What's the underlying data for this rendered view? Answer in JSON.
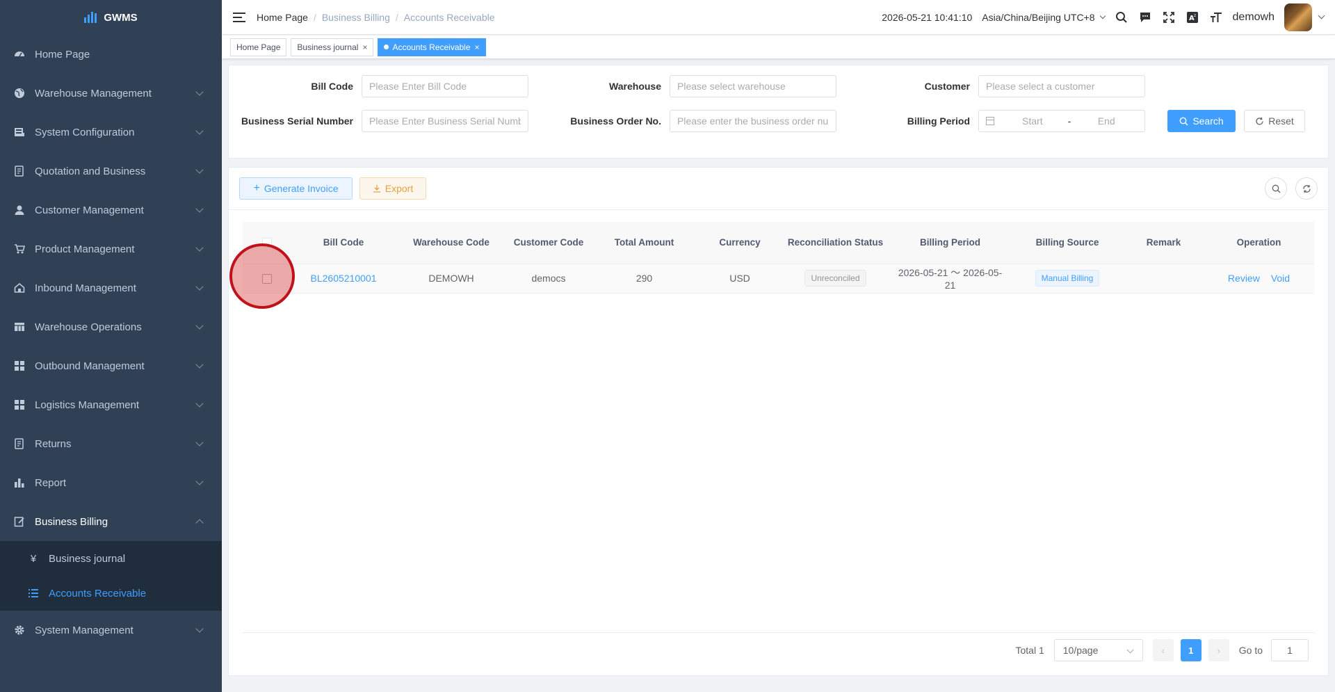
{
  "app": {
    "logo_text": "GWMS"
  },
  "sidebar": {
    "items": [
      {
        "label": "Home Page",
        "icon": "dashboard-icon"
      },
      {
        "label": "Warehouse Management",
        "icon": "globe-icon"
      },
      {
        "label": "System Configuration",
        "icon": "server-icon"
      },
      {
        "label": "Quotation and Business",
        "icon": "document-icon"
      },
      {
        "label": "Customer Management",
        "icon": "user-icon"
      },
      {
        "label": "Product Management",
        "icon": "cart-icon"
      },
      {
        "label": "Inbound Management",
        "icon": "home-icon"
      },
      {
        "label": "Warehouse Operations",
        "icon": "table-icon"
      },
      {
        "label": "Outbound Management",
        "icon": "grid-icon"
      },
      {
        "label": "Logistics Management",
        "icon": "grid-icon"
      },
      {
        "label": "Returns",
        "icon": "document-icon"
      },
      {
        "label": "Report",
        "icon": "bar-chart-icon"
      },
      {
        "label": "Business Billing",
        "icon": "edit-icon"
      },
      {
        "label": "System Management",
        "icon": "gear-icon"
      }
    ],
    "billing_sub": [
      {
        "label": "Business journal",
        "icon": "yen-icon"
      },
      {
        "label": "Accounts Receivable",
        "icon": "list-icon"
      }
    ]
  },
  "header": {
    "breadcrumb": [
      "Home Page",
      "Business Billing",
      "Accounts Receivable"
    ],
    "datetime": "2026-05-21 10:41:10",
    "timezone": "Asia/China/Beijing UTC+8",
    "username": "demowh"
  },
  "tags": [
    {
      "label": "Home Page"
    },
    {
      "label": "Business journal"
    },
    {
      "label": "Accounts Receivable"
    }
  ],
  "search": {
    "bill_code_label": "Bill Code",
    "bill_code_placeholder": "Please Enter Bill Code",
    "warehouse_label": "Warehouse",
    "warehouse_placeholder": "Please select warehouse",
    "customer_label": "Customer",
    "customer_placeholder": "Please select a customer",
    "serial_label": "Business Serial Number",
    "serial_placeholder": "Please Enter Business Serial Number",
    "order_label": "Business Order No.",
    "order_placeholder": "Please enter the business order number",
    "period_label": "Billing Period",
    "period_start": "Start",
    "period_sep": "-",
    "period_end": "End",
    "search_btn": "Search",
    "reset_btn": "Reset"
  },
  "toolbar": {
    "generate_invoice": "Generate Invoice",
    "export": "Export"
  },
  "table": {
    "headers": {
      "bill_code": "Bill Code",
      "warehouse_code": "Warehouse Code",
      "customer_code": "Customer Code",
      "total_amount": "Total Amount",
      "currency": "Currency",
      "reconciliation_status": "Reconciliation Status",
      "billing_period": "Billing Period",
      "billing_source": "Billing Source",
      "remark": "Remark",
      "operation": "Operation"
    },
    "rows": [
      {
        "bill_code": "BL2605210001",
        "warehouse_code": "DEMOWH",
        "customer_code": "democs",
        "total_amount": "290",
        "currency": "USD",
        "reconciliation_status": "Unreconciled",
        "billing_period": "2026-05-21 ～ 2026-05-21",
        "billing_source": "Manual Billing",
        "remark": "",
        "op_review": "Review",
        "op_void": "Void"
      }
    ]
  },
  "pagination": {
    "total_text": "Total 1",
    "page_size": "10/page",
    "current_page": "1",
    "goto_label": "Go to",
    "goto_value": "1"
  }
}
